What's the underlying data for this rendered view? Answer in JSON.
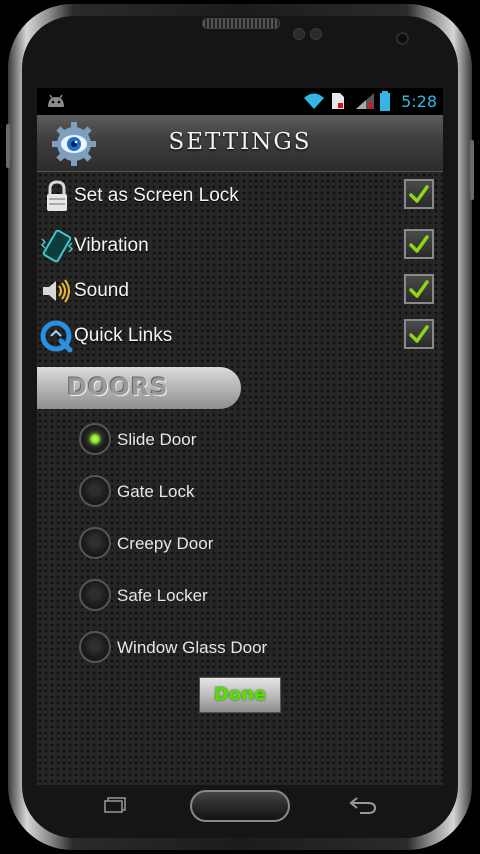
{
  "status_bar": {
    "time": "5:28",
    "icons": [
      "android-notification-icon",
      "wifi-icon",
      "sd-card-icon",
      "signal-icon",
      "battery-icon"
    ]
  },
  "header": {
    "title": "SETTINGS",
    "icon": "settings-eye-icon"
  },
  "settings": [
    {
      "id": "screen-lock",
      "label": "Set as Screen Lock",
      "icon": "lock-icon",
      "checked": true
    },
    {
      "id": "vibration",
      "label": "Vibration",
      "icon": "vibration-icon",
      "checked": true
    },
    {
      "id": "sound",
      "label": "Sound",
      "icon": "speaker-icon",
      "checked": true
    },
    {
      "id": "quick-links",
      "label": "Quick Links",
      "icon": "quicklinks-icon",
      "checked": true
    }
  ],
  "doors": {
    "section_label": "DOORS",
    "options": [
      {
        "label": "Slide Door",
        "selected": true
      },
      {
        "label": "Gate Lock",
        "selected": false
      },
      {
        "label": "Creepy Door",
        "selected": false
      },
      {
        "label": "Safe Locker",
        "selected": false
      },
      {
        "label": "Window Glass Door",
        "selected": false
      }
    ]
  },
  "done_button": {
    "label": "Done"
  },
  "colors": {
    "accent_green": "#57e000",
    "status_blue": "#33b5e5"
  }
}
